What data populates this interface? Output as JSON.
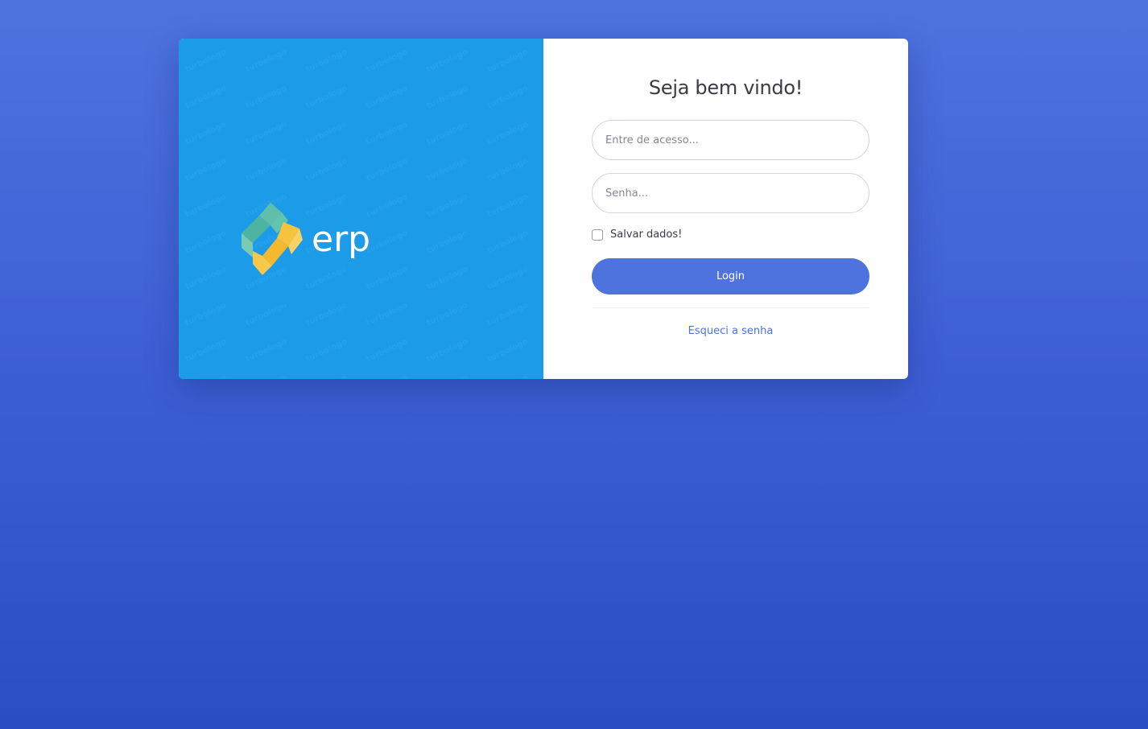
{
  "brand": {
    "logo_text": "erp",
    "watermark_text": "turbologo",
    "panel_color": "#1c9be8"
  },
  "form": {
    "title": "Seja bem vindo!",
    "username_placeholder": "Entre de acesso...",
    "password_placeholder": "Senha...",
    "remember_label": "Salvar dados!",
    "remember_checked": false,
    "login_label": "Login",
    "forgot_label": "Esqueci a senha"
  },
  "colors": {
    "accent": "#4e73df",
    "background_top": "#4e73df",
    "background_bottom": "#2a4ec2"
  }
}
